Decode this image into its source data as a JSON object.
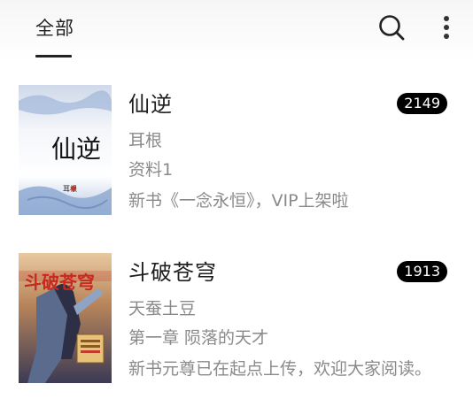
{
  "header": {
    "tab_label": "全部",
    "search_icon": "search-icon",
    "more_icon": "more-vertical-icon"
  },
  "books": [
    {
      "title": "仙逆",
      "count": "2149",
      "author": "耳根",
      "chapter": "资料1",
      "latest": "新书《一念永恒》，VIP上架啦",
      "cover_title": "仙逆",
      "cover_author": "耳根"
    },
    {
      "title": "斗破苍穹",
      "count": "1913",
      "author": "天蚕土豆",
      "chapter": "第一章 陨落的天才",
      "latest": "新书元尊已在起点上传，欢迎大家阅读。",
      "cover_title": "斗破苍穹"
    }
  ]
}
